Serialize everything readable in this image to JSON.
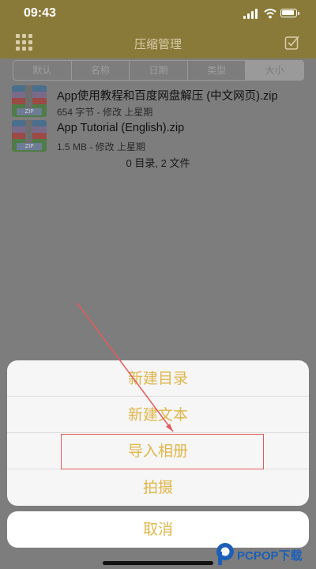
{
  "status_bar": {
    "time": "09:43"
  },
  "nav": {
    "title": "压缩管理"
  },
  "sort_tabs": [
    "默认",
    "名称",
    "日期",
    "类型",
    "大小"
  ],
  "files": [
    {
      "name": "App使用教程和百度网盘解压 (中文网页).zip",
      "meta": "654 字节 - 修改 上星期",
      "icon_label": "ZIP"
    },
    {
      "name": "App Tutorial (English).zip",
      "meta": "1.5 MB - 修改 上星期",
      "icon_label": "ZIP"
    }
  ],
  "summary": "0 目录, 2 文件",
  "action_sheet": {
    "items": [
      "新建目录",
      "新建文本",
      "导入相册",
      "拍摄"
    ],
    "cancel": "取消"
  },
  "watermark": {
    "text": "PCPOP下载"
  },
  "colors": {
    "nav_bar": "#8a7a39",
    "sheet_text": "#e0b64a",
    "annotation": "#e55a5a"
  }
}
